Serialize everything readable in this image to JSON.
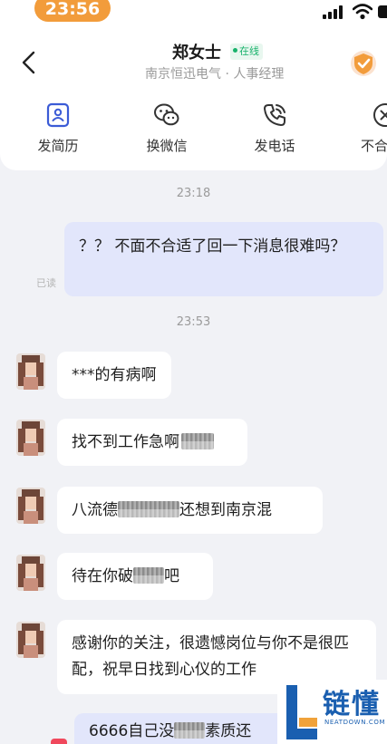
{
  "status_bar": {
    "time": "23:56"
  },
  "header": {
    "contact_name": "郑女士",
    "online_status": "在线",
    "company_role": "南京恒迅电气 · 人事经理",
    "back_icon": "chevron-left-icon",
    "verify_icon": "verified-check-icon"
  },
  "actions": [
    {
      "label": "发简历",
      "icon": "resume-icon"
    },
    {
      "label": "换微信",
      "icon": "wechat-icon"
    },
    {
      "label": "发电话",
      "icon": "phone-icon"
    },
    {
      "label": "不合",
      "icon": "close-icon"
    }
  ],
  "chat": {
    "timestamp_1": "23:18",
    "read_mark": "已读",
    "outgoing_1": "？？ 不面不合适了回一下消息很难吗？",
    "timestamp_2": "23:53",
    "incoming": [
      {
        "text": "***的有病啊"
      },
      {
        "text": "找不到工作急啊"
      },
      {
        "text_before": "八流德",
        "text_after": "还想到南京混"
      },
      {
        "text_before": "待在你破",
        "text_after": "吧"
      },
      {
        "text": "感谢你的关注，很遗憾岗位与你不是很匹配，祝早日找到心仪的工作"
      }
    ],
    "outgoing_2_before": "6666自己没",
    "outgoing_2_after": "素质还"
  },
  "colors": {
    "accent_orange": "#f29c3b",
    "online_green": "#18b26b",
    "outgoing_bubble": "#e2e6fb",
    "background": "#f1f2f6"
  },
  "watermark": {
    "brand": "链懂",
    "site": "NEATDOWN.COM"
  }
}
